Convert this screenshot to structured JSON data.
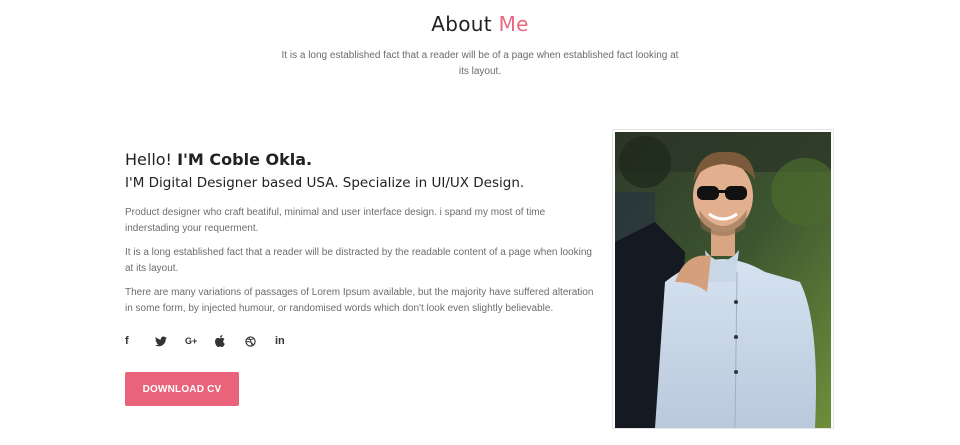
{
  "header": {
    "title_main": "About",
    "title_accent": "Me",
    "subtitle": "It is a long established fact that a reader will be of a page when established fact looking at its layout."
  },
  "about": {
    "hello_prefix": "Hello!",
    "hello_name": "I'M Coble Okla.",
    "tagline": "I'M Digital Designer based USA. Specialize in UI/UX Design.",
    "paragraphs": [
      "Product designer who craft beatiful, minimal and user interface design. i spand my most of time inderstading your requerment.",
      "It is a long established fact that a reader will be distracted by the readable content of a page when looking at its layout.",
      "There are many variations of passages of Lorem Ipsum available, but the majority have suffered alteration in some form, by injected humour, or randomised words which don't look even slightly believable."
    ],
    "social": [
      {
        "icon": "facebook-icon",
        "glyph": "f"
      },
      {
        "icon": "twitter-icon",
        "glyph": ""
      },
      {
        "icon": "google-plus-icon",
        "glyph": "G+"
      },
      {
        "icon": "apple-icon",
        "glyph": ""
      },
      {
        "icon": "dribbble-icon",
        "glyph": ""
      },
      {
        "icon": "linkedin-icon",
        "glyph": "in"
      }
    ],
    "download_label": "DOWNLOAD CV"
  },
  "colors": {
    "accent": "#e9697f",
    "button": "#e9637a",
    "text_dark": "#222222",
    "text_muted": "#6d6d6d"
  }
}
